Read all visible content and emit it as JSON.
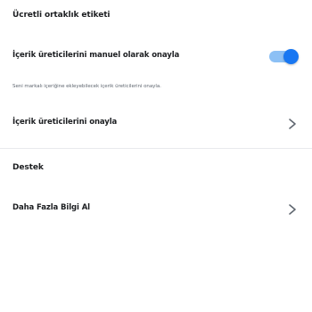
{
  "section_partner_label": {
    "title": "Ücretli ortaklık etiketi"
  },
  "manual_approve": {
    "label": "İçerik üreticilerini manuel olarak onayla",
    "enabled": true,
    "description": "Seni markalı içeriğine ekleyebilecek içerik üreticilerini onayla."
  },
  "approve_creators": {
    "label": "İçerik üreticilerini onayla"
  },
  "section_support": {
    "title": "Destek"
  },
  "learn_more": {
    "label": "Daha Fazla Bilgi Al"
  },
  "colors": {
    "accent": "#1877f2",
    "track": "#8cc0f5",
    "text": "#1c1e21",
    "secondary_text": "#606770"
  },
  "icons": {
    "chevron": "chevron-right-icon"
  }
}
